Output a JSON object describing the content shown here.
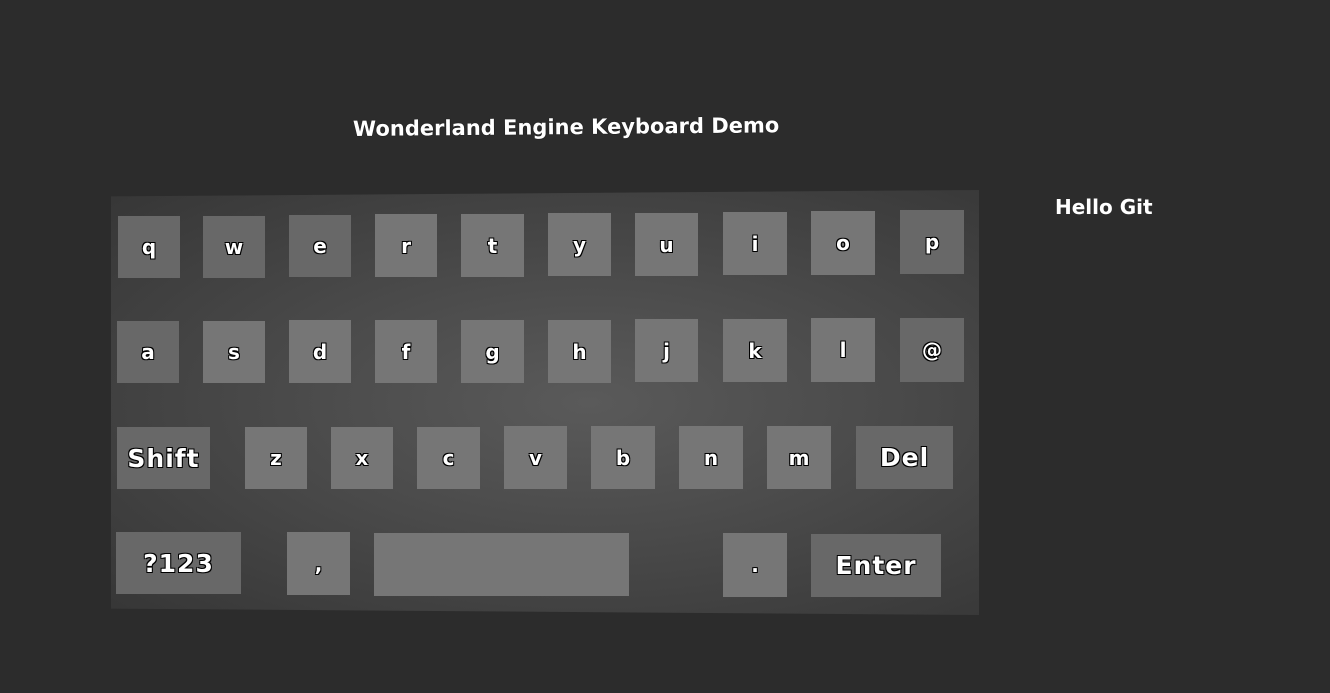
{
  "title": "Wonderland Engine Keyboard Demo",
  "output_text": "Hello Git",
  "keyboard": {
    "row1": [
      "q",
      "w",
      "e",
      "r",
      "t",
      "y",
      "u",
      "i",
      "o",
      "p"
    ],
    "row2": [
      "a",
      "s",
      "d",
      "f",
      "g",
      "h",
      "j",
      "k",
      "l",
      "@"
    ],
    "row3": {
      "shift": "Shift",
      "letters": [
        "z",
        "x",
        "c",
        "v",
        "b",
        "n",
        "m"
      ],
      "del": "Del"
    },
    "row4": {
      "mode": "?123",
      "comma": ",",
      "space": "",
      "period": ".",
      "enter": "Enter"
    }
  },
  "colors": {
    "background": "#2c2c2c",
    "key": "#767676",
    "text": "#ffffff"
  }
}
